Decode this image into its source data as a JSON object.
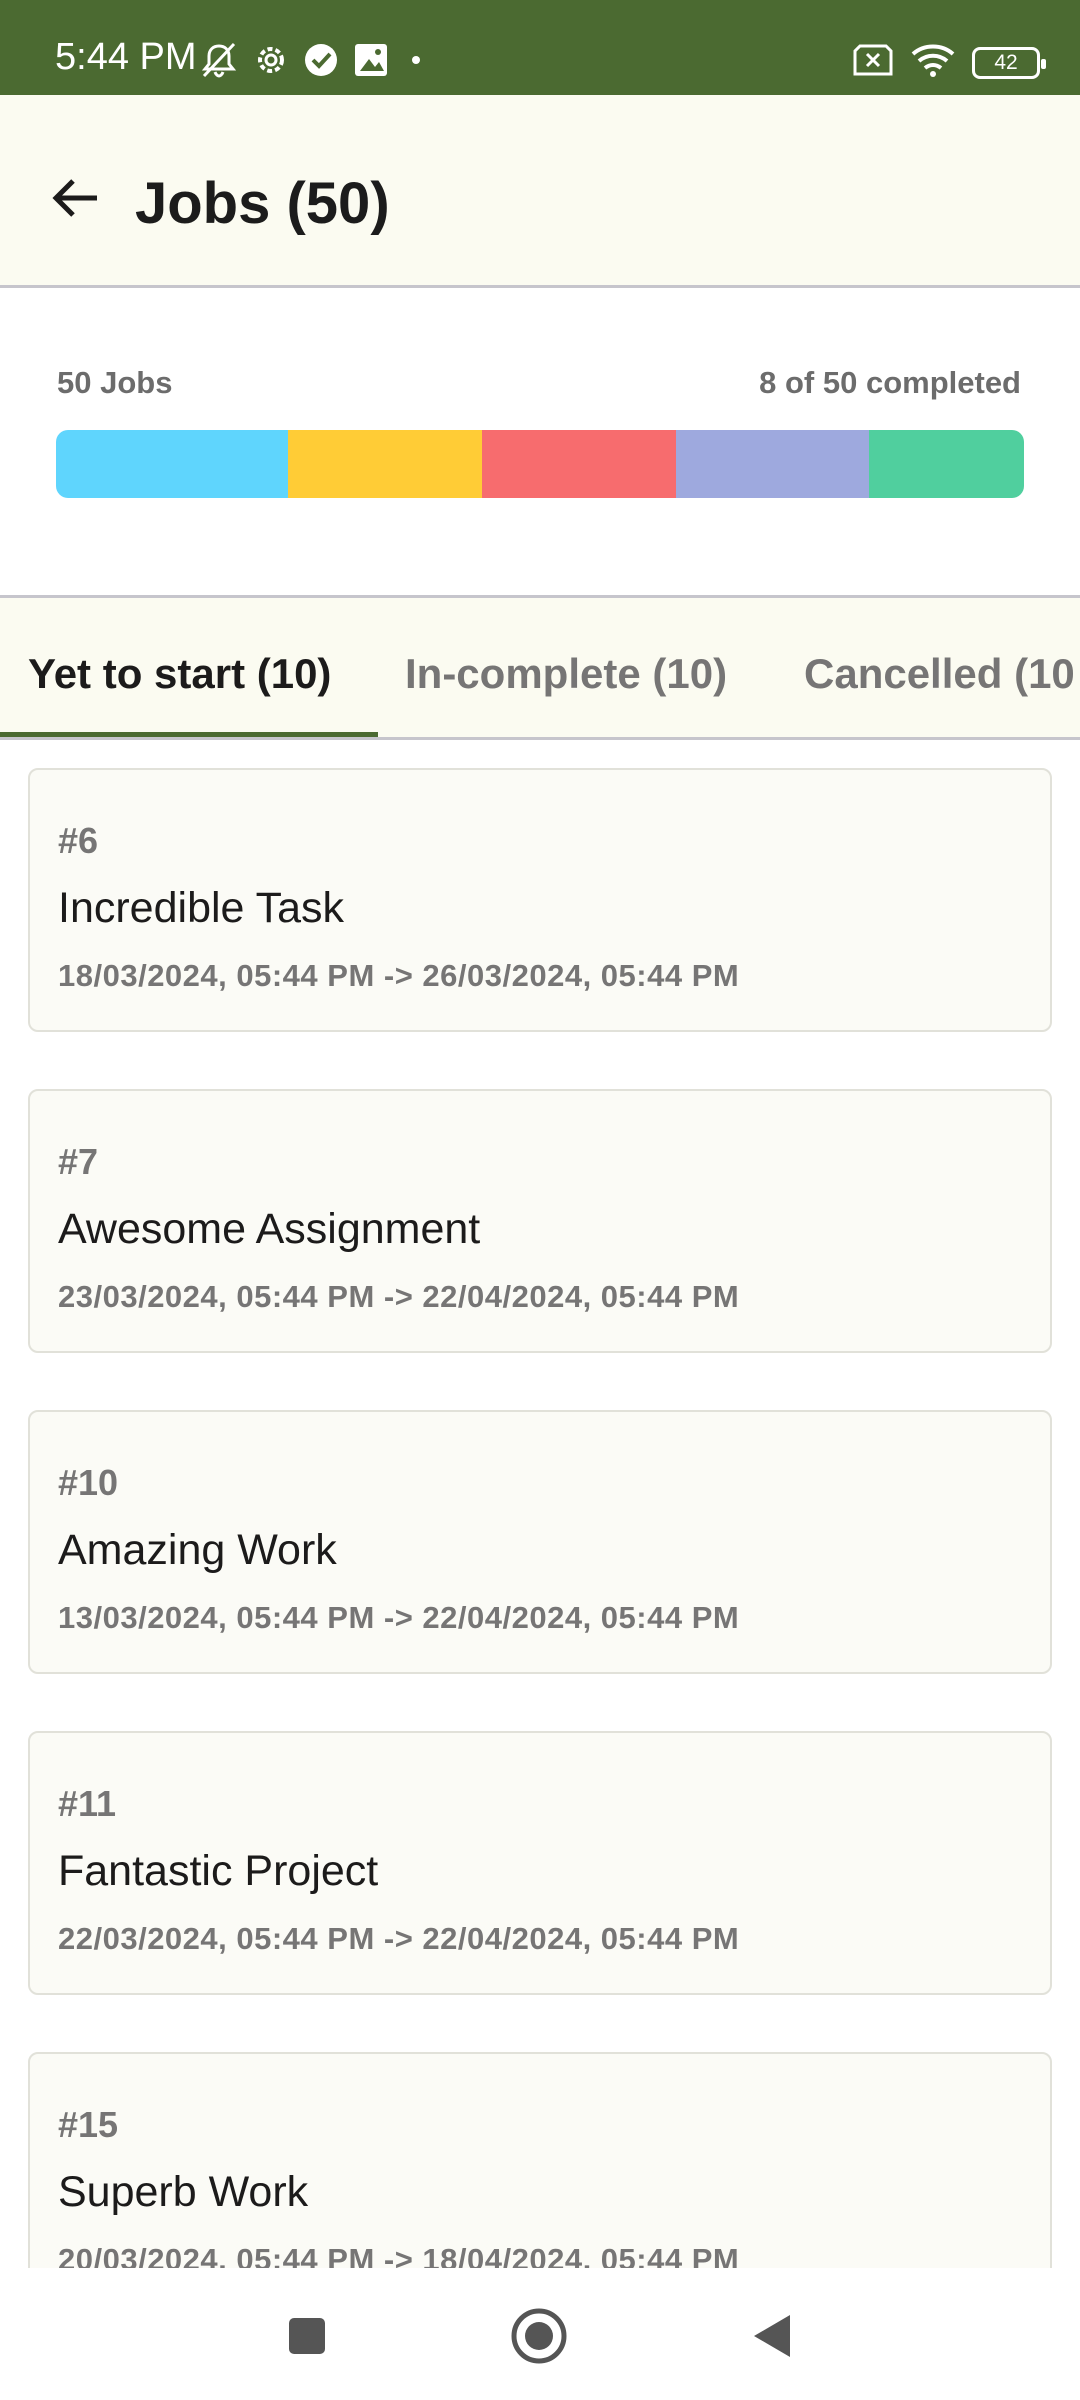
{
  "status_bar": {
    "time": "5:44 PM",
    "battery": "42"
  },
  "app_bar": {
    "title": "Jobs (50)"
  },
  "summary": {
    "total_label": "50 Jobs",
    "completed_label": "8 of 50 completed",
    "segments": [
      {
        "color": "#5fd5fd",
        "share": 0.24
      },
      {
        "color": "#ffcc36",
        "share": 0.2
      },
      {
        "color": "#f76c6e",
        "share": 0.2
      },
      {
        "color": "#9ea9de",
        "share": 0.2
      },
      {
        "color": "#50cf9e",
        "share": 0.16
      }
    ]
  },
  "tabs": [
    {
      "label": "Yet to start (10)",
      "active": true
    },
    {
      "label": "In-complete (10)",
      "active": false
    },
    {
      "label": "Cancelled (10",
      "active": false
    }
  ],
  "jobs": [
    {
      "number": "#6",
      "title": "Incredible Task",
      "dates": "18/03/2024, 05:44 PM -> 26/03/2024, 05:44 PM"
    },
    {
      "number": "#7",
      "title": "Awesome Assignment",
      "dates": "23/03/2024, 05:44 PM -> 22/04/2024, 05:44 PM"
    },
    {
      "number": "#10",
      "title": "Amazing Work",
      "dates": "13/03/2024, 05:44 PM -> 22/04/2024, 05:44 PM"
    },
    {
      "number": "#11",
      "title": "Fantastic Project",
      "dates": "22/03/2024, 05:44 PM -> 22/04/2024, 05:44 PM"
    },
    {
      "number": "#15",
      "title": "Superb Work",
      "dates": "20/03/2024, 05:44 PM -> 18/04/2024, 05:44 PM"
    }
  ],
  "colors": {
    "accent": "#4b6a31",
    "app_bar_bg": "#fbfbf1"
  },
  "icons": {
    "status": [
      "mute-icon",
      "settings-icon",
      "check-circle-icon",
      "image-icon",
      "no-sim-icon",
      "wifi-icon",
      "battery-icon"
    ],
    "app_bar": "back-arrow-icon",
    "nav": [
      "recents-square-icon",
      "home-circle-icon",
      "back-triangle-icon"
    ]
  }
}
